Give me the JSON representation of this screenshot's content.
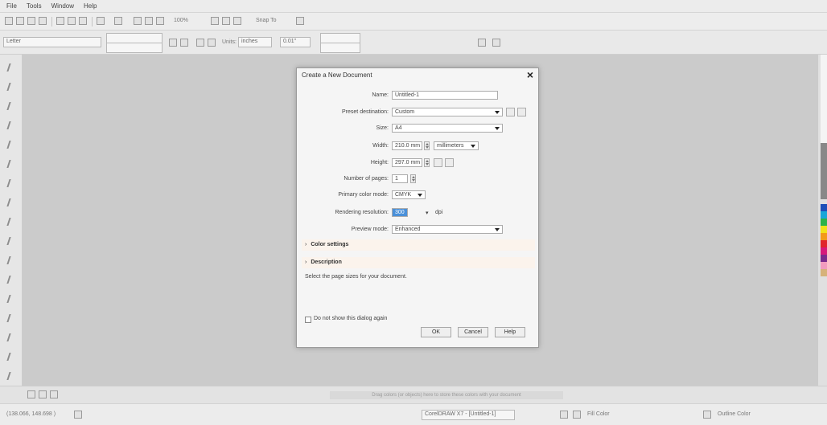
{
  "menubar": {
    "items": [
      "File",
      "Tools",
      "Window",
      "Help"
    ]
  },
  "toolbar": {
    "zoom": "100%",
    "snap_to": "Snap To",
    "font_selector": "Letter",
    "units_label": "Units:",
    "units_value": "inches",
    "nudge": "0.01\""
  },
  "dialog": {
    "title": "Create a New Document",
    "name_label": "Name:",
    "name_value": "Untitled-1",
    "preset_label": "Preset destination:",
    "preset_value": "Custom",
    "size_label": "Size:",
    "size_value": "A4",
    "width_label": "Width:",
    "width_value": "210.0 mm",
    "units_value": "millimeters",
    "height_label": "Height:",
    "height_value": "297.0 mm",
    "pages_label": "Number of pages:",
    "pages_value": "1",
    "color_mode_label": "Primary color mode:",
    "color_mode_value": "CMYK",
    "resolution_label": "Rendering resolution:",
    "resolution_value": "300",
    "resolution_unit": "dpi",
    "preview_label": "Preview mode:",
    "preview_value": "Enhanced",
    "color_settings_label": "Color settings",
    "description_label": "Description",
    "description_text": "Select the page sizes for your document.",
    "dont_show_label": "Do not show this dialog again",
    "ok_label": "OK",
    "cancel_label": "Cancel",
    "help_label": "Help"
  },
  "status": {
    "coordinates": "(138.066, 148.698 )",
    "hint": "Drag colors (or objects) here to store these colors with your document",
    "doc_info": "CorelDRAW X7 - [Untitled-1]",
    "fill_label": "Fill Color",
    "outline_label": "Outline Color"
  },
  "colors": {
    "dialog_bg": "#f5f5f5",
    "canvas_bg": "#cbcbcb",
    "highlight": "#4a90d9",
    "section_bg": "#fbf3ec"
  }
}
